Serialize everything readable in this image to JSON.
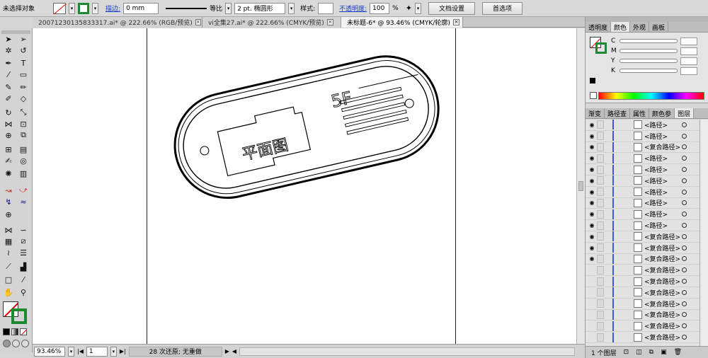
{
  "control_bar": {
    "selection_label": "未选择对象",
    "stroke_label": "描边:",
    "stroke_value": "0 mm",
    "proportion_label": "等比",
    "brush_value": "2 pt. 椭圆形",
    "style_label": "样式:",
    "opacity_label": "不透明度:",
    "opacity_value": "100",
    "opacity_unit": "%",
    "doc_setup_button": "文档设置",
    "prefs_button": "首选项"
  },
  "tabs": [
    {
      "label": "20071230135833317.ai* @ 222.66% (RGB/预览)"
    },
    {
      "label": "vi全集27.ai* @ 222.66% (CMYK/预览)"
    },
    {
      "label": "未标题-6* @ 93.46% (CMYK/轮廓)"
    }
  ],
  "artwork": {
    "floor_text": "5F",
    "plan_text": "平面图"
  },
  "status_bar": {
    "zoom": "93.46%",
    "page": "1",
    "status_text": "28 次还原; 无重做"
  },
  "color_panel": {
    "tabs": [
      "透明度",
      "颜色",
      "外观",
      "画板"
    ],
    "channels": [
      "C",
      "M",
      "Y",
      "K"
    ]
  },
  "layers_panel": {
    "tabs": [
      "渐变",
      "路径查",
      "属性",
      "颜色参",
      "图层"
    ],
    "items": [
      {
        "name": "<路径>",
        "visible": true
      },
      {
        "name": "<路径>",
        "visible": true
      },
      {
        "name": "<复合路径>",
        "visible": true
      },
      {
        "name": "<路径>",
        "visible": true
      },
      {
        "name": "<路径>",
        "visible": true
      },
      {
        "name": "<路径>",
        "visible": true
      },
      {
        "name": "<路径>",
        "visible": true
      },
      {
        "name": "<路径>",
        "visible": true
      },
      {
        "name": "<路径>",
        "visible": true
      },
      {
        "name": "<路径>",
        "visible": true
      },
      {
        "name": "<复合路径>",
        "visible": true
      },
      {
        "name": "<复合路径>",
        "visible": true
      },
      {
        "name": "<复合路径>",
        "visible": true
      },
      {
        "name": "<复合路径>",
        "visible": false
      },
      {
        "name": "<复合路径>",
        "visible": false
      },
      {
        "name": "<复合路径>",
        "visible": false
      },
      {
        "name": "<复合路径>",
        "visible": false
      },
      {
        "name": "<复合路径>",
        "visible": false
      },
      {
        "name": "<复合路径>",
        "visible": false
      },
      {
        "name": "<复合路径>",
        "visible": false
      }
    ],
    "footer_count": "1 个图层"
  }
}
